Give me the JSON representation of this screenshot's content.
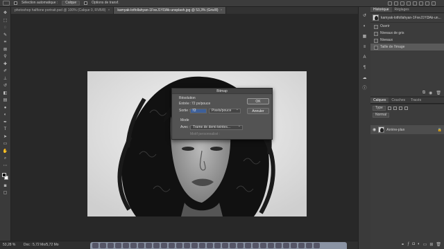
{
  "options_bar": {
    "auto_select_label": "Sélection automatique :",
    "auto_select_value": "Calque",
    "transform_label": "Options de transf."
  },
  "tabs": [
    {
      "label": "photoshop halftone portrait.psd @ 100% (Calque 0, RVB/8)"
    },
    {
      "label": "kamyak-lotfollahyan-1FxeJ1Yl3Ak-unsplash.jpg @ 53,3% (Gris/8)"
    }
  ],
  "dialog": {
    "title": "Bitmap",
    "resolution_label": "Résolution",
    "input_label": "Entrée :",
    "input_value": "72 px/pouce",
    "output_label": "Sortie :",
    "output_value": "72",
    "output_unit": "Pixels/pouce",
    "mode_label": "Mode",
    "with_label": "Avec :",
    "with_value": "Trame de demi-teintes...",
    "custom_pattern_label": "Motif personnalisé :",
    "ok_label": "OK",
    "cancel_label": "Annuler"
  },
  "status": {
    "zoom": "53,28 %",
    "doc": "Doc : 5,72 Mo/5,72 Mo"
  },
  "history_panel": {
    "tabs": [
      "Historique",
      "Réglages"
    ],
    "snapshot": "kamyak-lotfollahyan-1FxeJ1Yl3Ak-un...",
    "items": [
      "Ouvrir",
      "Niveaux de gris",
      "Niveaux",
      "Taille de l'image"
    ]
  },
  "layers_panel": {
    "tabs": [
      "Calques",
      "Couches",
      "Tracés"
    ],
    "kind": "Type",
    "blend": "Normal",
    "layer_name": "Arrière-plan"
  },
  "colors": {
    "ui_dark": "#2b2b2b",
    "panel": "#3c3c3c",
    "dialog": "#535353"
  }
}
